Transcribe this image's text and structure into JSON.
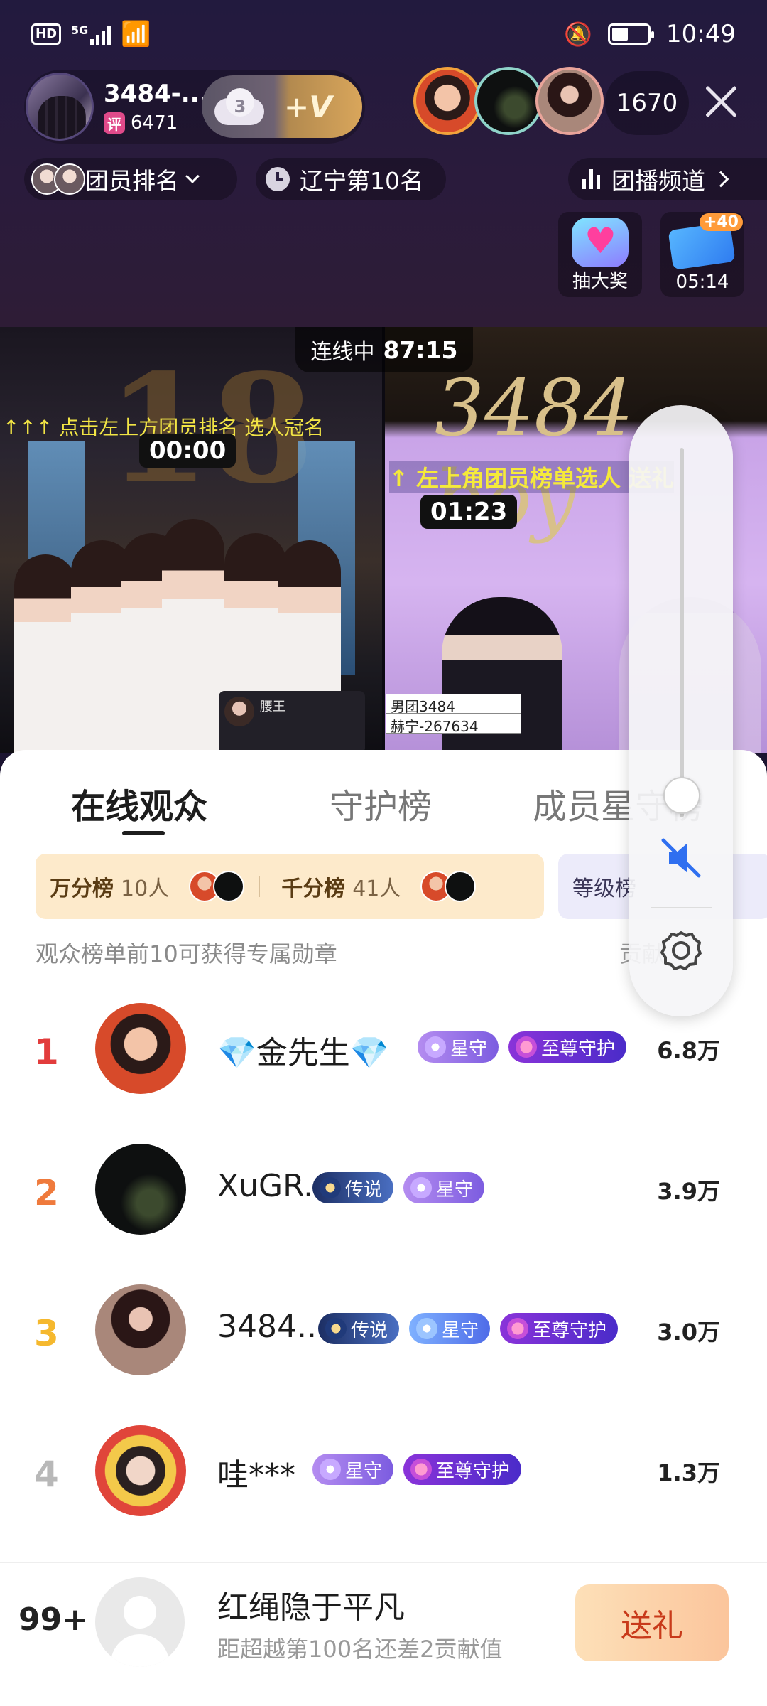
{
  "status_bar": {
    "hd": "HD",
    "network": "5G",
    "time": "10:49",
    "battery_level": 0.45
  },
  "anchor": {
    "name": "3484-...",
    "rating_tag": "评",
    "rating_value": "6471",
    "follow_count": "3",
    "follow_label": "+V"
  },
  "viewers": {
    "online_count": "1670"
  },
  "row2": {
    "members_label": "团员排名",
    "rank_label": "辽宁第10名",
    "channel_label": "团播频道"
  },
  "activities": {
    "lottery_label": "抽大奖",
    "timer_badge": "+40",
    "timer_value": "05:14"
  },
  "video": {
    "connect_label": "连线中",
    "connect_time": "87:15",
    "left_marquee": "↑↑↑ 点击左上方团员排名  选人冠名",
    "left_timer": "00:00",
    "right_marquee": "↑ 左上角团员榜单选人   送礼",
    "right_timer": "01:23",
    "mini_card_name": "腰王",
    "logo_text": "3484 boy",
    "score_rows": [
      "男团3484",
      "赫宁-267634"
    ]
  },
  "sheet": {
    "tabs": [
      "在线观众",
      "守护榜",
      "成员星守榜"
    ],
    "boards": {
      "wan_label": "万分榜",
      "wan_count": "10人",
      "qian_label": "千分榜",
      "qian_count": "41人",
      "level_label": "等级榜"
    },
    "hint": "观众榜单前10可获得专属勋章",
    "hint_right": "贡献"
  },
  "ranking": [
    {
      "rank": "1",
      "name": "💎金先生💎",
      "score": "6.8万",
      "rank_color": "#e23c3c",
      "badges": [
        {
          "style": "b-xing",
          "label": "星守"
        },
        {
          "style": "b-zhizun",
          "label": "至尊守护"
        }
      ]
    },
    {
      "rank": "2",
      "name": "XuGR.",
      "score": "3.9万",
      "rank_color": "#ef7a3c",
      "badges": [
        {
          "style": "b-legend",
          "label": "传说"
        },
        {
          "style": "b-xing",
          "label": "星守"
        }
      ]
    },
    {
      "rank": "3",
      "name": "3484...",
      "score": "3.0万",
      "rank_color": "#f5b82e",
      "badges": [
        {
          "style": "b-legend",
          "label": "传说"
        },
        {
          "style": "b-xing-blue",
          "label": "星守"
        },
        {
          "style": "b-zhizun",
          "label": "至尊守护"
        }
      ]
    },
    {
      "rank": "4",
      "name": "哇***",
      "score": "1.3万",
      "rank_color": "#b8b8b8",
      "badges": [
        {
          "style": "b-xing",
          "label": "星守"
        },
        {
          "style": "b-zhizun",
          "label": "至尊守护"
        }
      ]
    }
  ],
  "me": {
    "rank": "99+",
    "name": "红绳隐于平凡",
    "sub": "距超越第100名还差2贡献值",
    "gift_label": "送礼"
  },
  "volume": {
    "level": 0.06,
    "muted": true
  }
}
